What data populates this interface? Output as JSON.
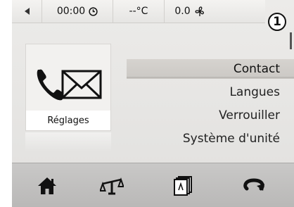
{
  "status_bar": {
    "back_icon": "back-arrow-icon",
    "time": "00:00",
    "clock_icon": "clock-icon",
    "temperature": "--°C",
    "fan_value": "0.0",
    "fan_icon": "fan-icon"
  },
  "callout_badge": "1",
  "tile": {
    "icon": "phone-envelope-icon",
    "label": "Réglages"
  },
  "menu": {
    "items": [
      {
        "label": "Contact",
        "selected": true
      },
      {
        "label": "Langues",
        "selected": false
      },
      {
        "label": "Verrouiller",
        "selected": false
      },
      {
        "label": "Système d'unité",
        "selected": false
      }
    ]
  },
  "bottom_bar": {
    "buttons": [
      "home-icon",
      "balance-scale-icon",
      "pages-icon",
      "return-icon"
    ]
  },
  "colors": {
    "screen_bg": "#e6e5e3",
    "selected_bg": "#d0cdc9",
    "bottom_bar_bg": "#c2c1c0",
    "text": "#222222"
  }
}
